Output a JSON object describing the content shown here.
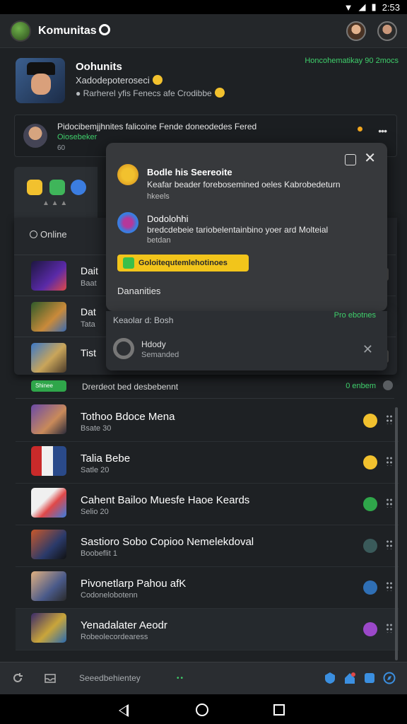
{
  "status_bar": {
    "time": "2:53"
  },
  "app_bar": {
    "title": "Komunitas"
  },
  "community": {
    "name": "Oohunits",
    "subtitle": "Xadodepoteroseci",
    "meta": "Rarherel yfis Fenecs afe Crodibbe",
    "link": "Honcohematikay 90 2mocs"
  },
  "post": {
    "text": "Pidocibemjjhnites falicoine Fende doneodedes Fered",
    "sub": "Oiosebeker",
    "time": "60"
  },
  "sheet": {
    "online_label": "Online",
    "rows": [
      {
        "title": "Dait",
        "sub": "Baat"
      },
      {
        "title": "Dat",
        "sub": "Tata"
      },
      {
        "title": "Tist",
        "sub": ""
      }
    ]
  },
  "modal": {
    "item1": {
      "title": "Bodle his Seereoite",
      "text": "Keafar beader forebosemined oeles Kabrobedeturn",
      "meta": "hkeels"
    },
    "item2": {
      "title": "Dodolohhi",
      "text": "bredcdebeie tariobelentainbino yoer ard Molteial",
      "meta": "betdan"
    },
    "button_label": "Goloitequtemlehotinoes",
    "footer": "Dananities"
  },
  "toast": {
    "line_a": "Keaolar d: Bosh",
    "line_b": "Pro ebotnes",
    "title": "Hdody",
    "sub": "Semanded"
  },
  "activity": {
    "badge": "Shinee",
    "text": "Drerdeot bed desbebennt",
    "right": "0 enbem"
  },
  "list": [
    {
      "title": "Tothoo Bdoce Mena",
      "sub": "Bsate 30",
      "badge_color": "#f2c12e"
    },
    {
      "title": "Talia Bebe",
      "sub": "Satle 20",
      "badge_color": "#f2c12e"
    },
    {
      "title": "Cahent Bailoo Muesfe Haoe Keards",
      "sub": "Selio 20",
      "badge_color": "#2fa64a"
    },
    {
      "title": "Sastioro Sobo Copioo Nemelekdoval",
      "sub": "Boobeflit 1",
      "badge_color": "#3a5a5a"
    },
    {
      "title": "Pivonetlarp Pahou afK",
      "sub": "Codonelobotenn",
      "badge_color": "#2f6fb5"
    },
    {
      "title": "Yenadalater Aeodr",
      "sub": "Robeolecordearess",
      "badge_color": "#9b48c9"
    }
  ],
  "bottom_bar": {
    "text": "Seeedbehientey"
  }
}
